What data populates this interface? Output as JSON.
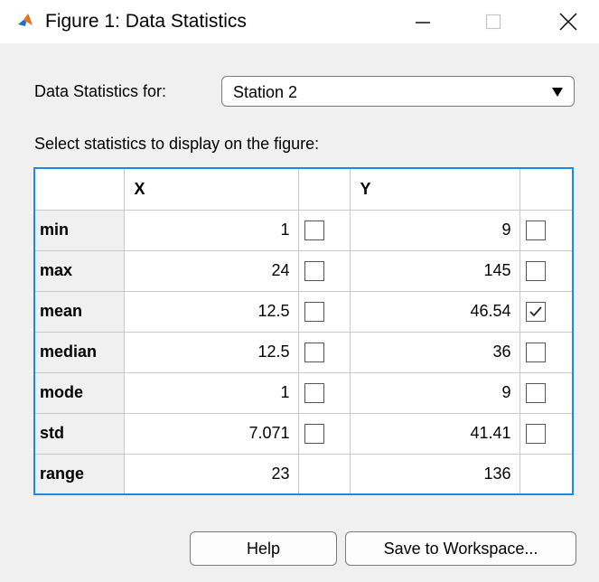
{
  "window": {
    "title": "Figure 1: Data Statistics",
    "icon": "matlab-icon",
    "controls": [
      "minimize-icon",
      "maximize-icon",
      "close-icon"
    ]
  },
  "station": {
    "label": "Data Statistics for:",
    "selected": "Station 2"
  },
  "instructions": "Select statistics to display on the figure:",
  "table": {
    "headers": {
      "x": "X",
      "y": "Y"
    },
    "rows": [
      {
        "name": "min",
        "x": "1",
        "x_checked": false,
        "y": "9",
        "y_checked": false
      },
      {
        "name": "max",
        "x": "24",
        "x_checked": false,
        "y": "145",
        "y_checked": false
      },
      {
        "name": "mean",
        "x": "12.5",
        "x_checked": false,
        "y": "46.54",
        "y_checked": true
      },
      {
        "name": "median",
        "x": "12.5",
        "x_checked": false,
        "y": "36",
        "y_checked": false
      },
      {
        "name": "mode",
        "x": "1",
        "x_checked": false,
        "y": "9",
        "y_checked": false
      },
      {
        "name": "std",
        "x": "7.071",
        "x_checked": false,
        "y": "41.41",
        "y_checked": false
      },
      {
        "name": "range",
        "x": "23",
        "y": "136"
      }
    ]
  },
  "buttons": {
    "help": "Help",
    "save": "Save to Workspace..."
  },
  "colors": {
    "table_border": "#1e88e5",
    "background": "#f0f0f0"
  }
}
